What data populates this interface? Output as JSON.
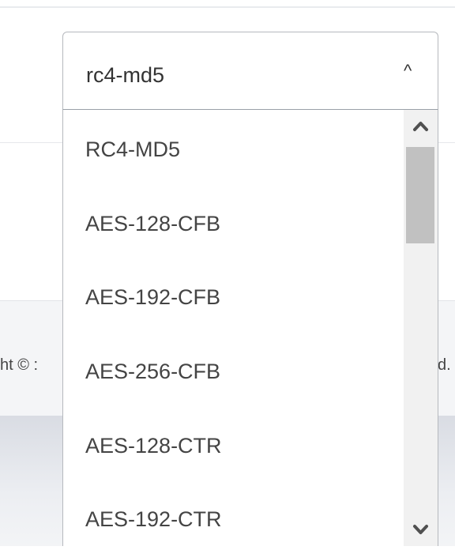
{
  "select": {
    "value": "rc4-md5",
    "caret": "^"
  },
  "footer": {
    "left_fragment": "ht © :",
    "right_fragment": "d."
  },
  "dropdown": {
    "options": [
      "RC4-MD5",
      "AES-128-CFB",
      "AES-192-CFB",
      "AES-256-CFB",
      "AES-128-CTR",
      "AES-192-CTR"
    ]
  },
  "scrollbar": {
    "up_icon": "chevron-up-icon",
    "down_icon": "chevron-down-icon"
  }
}
